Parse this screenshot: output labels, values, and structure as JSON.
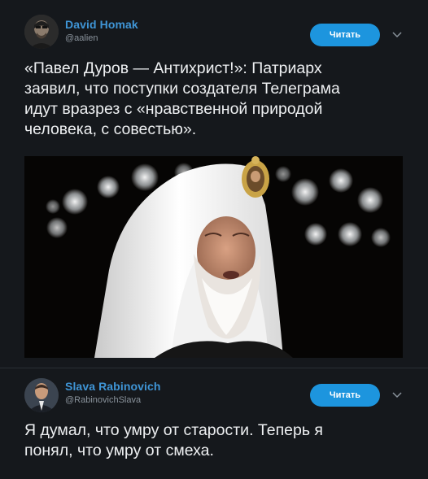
{
  "tweets": [
    {
      "author_name": "David Homak",
      "author_handle": "@aalien",
      "follow_label": "Читать",
      "text": "«Павел Дуров — Антихрист!»: Патриарх\nзаявил, что поступки создателя Телеграма\nидут вразрез с «нравственной природой\nчеловека, с совестью».",
      "has_photo": true,
      "photo_icon": "portrait-photo"
    },
    {
      "author_name": "Slava Rabinovich",
      "author_handle": "@RabinovichSlava",
      "follow_label": "Читать",
      "text": "Я думал, что умру от старости. Теперь я\nпонял, что умру от смеха."
    }
  ],
  "colors": {
    "background": "#15181c",
    "author_name": "#3f95d6",
    "follow_button": "#1d95de",
    "handle": "#8a939c",
    "text": "#eef0f2"
  },
  "icons": {
    "menu": "chevron-down-icon"
  }
}
